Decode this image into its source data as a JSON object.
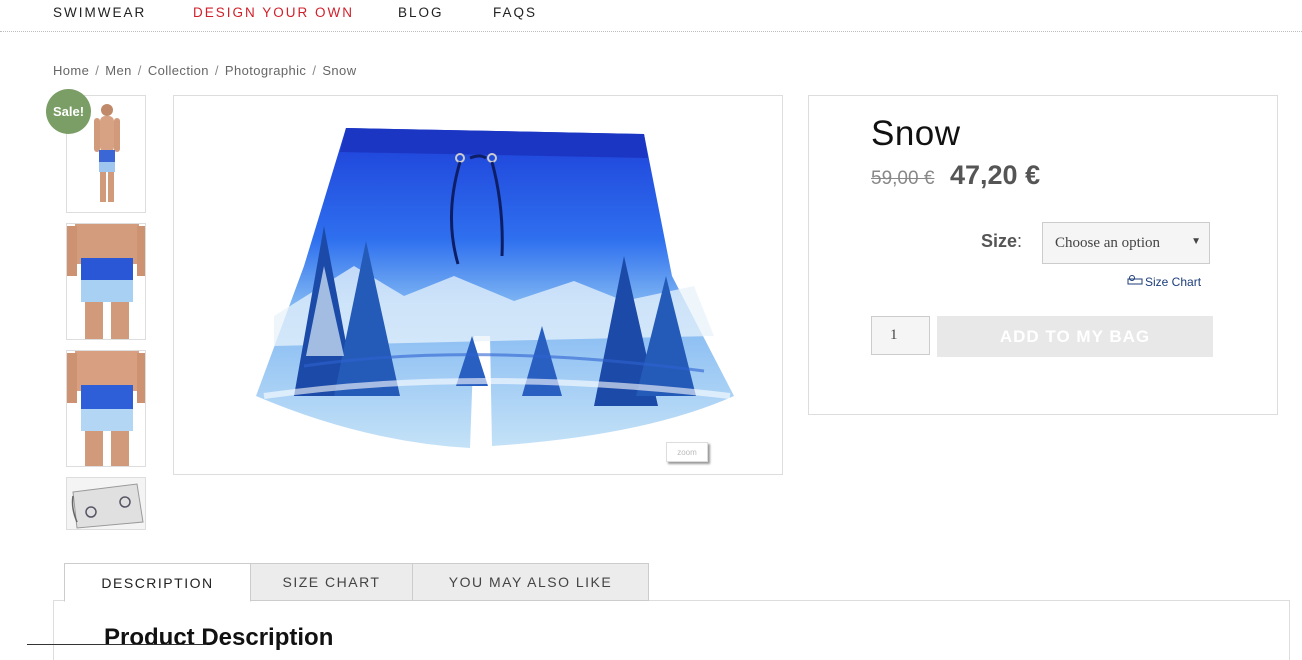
{
  "nav": {
    "items": [
      "SWIMWEAR",
      "DESIGN YOUR OWN",
      "BLOG",
      "FAQS"
    ],
    "active_color": "#d0212b"
  },
  "breadcrumb": [
    "Home",
    "Men",
    "Collection",
    "Photographic",
    "Snow"
  ],
  "gallery": {
    "sale_badge": "Sale!",
    "sale_color": "#7a9e66",
    "zoom_label": "zoom"
  },
  "product": {
    "title": "Snow",
    "old_price": "59,00 €",
    "new_price": "47,20 €",
    "size_label": "Size",
    "size_colon": ":",
    "size_selected": "Choose an option",
    "size_chart_link": "Size Chart",
    "quantity": "1",
    "add_to_bag": "ADD TO MY BAG"
  },
  "tabs": [
    "DESCRIPTION",
    "SIZE CHART",
    "YOU MAY ALSO LIKE"
  ],
  "panel": {
    "heading": "Product Description"
  }
}
